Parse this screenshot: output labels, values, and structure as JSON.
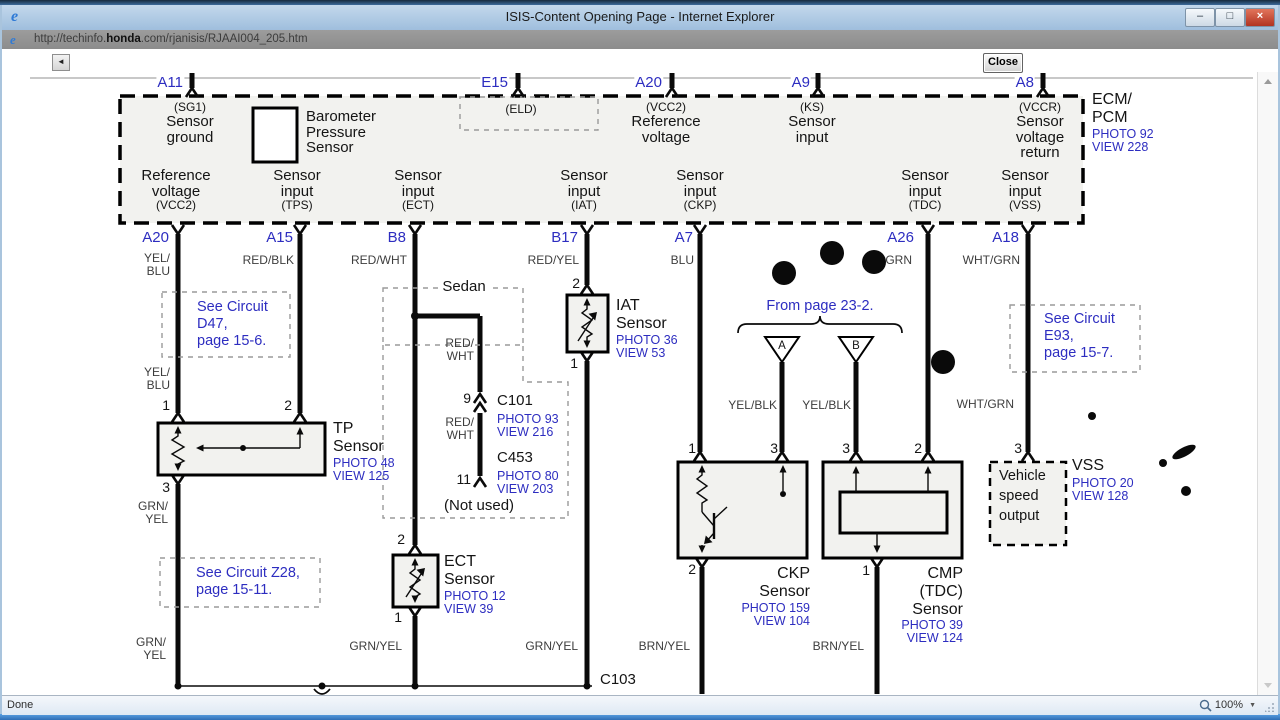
{
  "window": {
    "title": "ISIS-Content Opening Page - Internet Explorer",
    "controls": {
      "minimize": "–",
      "maximize": "□",
      "close": "×"
    }
  },
  "urlbar": {
    "prefix": "http://techinfo.",
    "domain": "honda",
    "suffix": ".com/rjanisis/RJAAI004_205.htm"
  },
  "toolbar": {
    "back": "◄",
    "close": "Close"
  },
  "statusbar": {
    "status": "Done",
    "zoom": "100%",
    "dropdown": "▼"
  },
  "colors": {
    "link_blue": "#2d2dc0",
    "wire_label": "#3d3d3d"
  },
  "ecm": {
    "title": "ECM/\nPCM",
    "photo": "PHOTO 92",
    "view": "VIEW 228",
    "pins_top": {
      "a11": {
        "id": "A11",
        "sub": "(SG1)",
        "desc": "Sensor\nground"
      },
      "e15": {
        "id": "E15",
        "sub": "(ELD)"
      },
      "a20": {
        "id": "A20",
        "sub": "(VCC2)",
        "desc": "Reference\nvoltage"
      },
      "a9": {
        "id": "A9",
        "sub": "(KS)",
        "desc": "Sensor\ninput"
      },
      "a8": {
        "id": "A8",
        "sub": "(VCCR)",
        "desc": "Sensor\nvoltage\nreturn"
      }
    },
    "barometer": "Barometer\nPressure\nSensor",
    "row_bottom": {
      "vcc2": {
        "desc": "Reference\nvoltage",
        "sub": "(VCC2)"
      },
      "tps": {
        "desc": "Sensor\ninput",
        "sub": "(TPS)"
      },
      "ect": {
        "desc": "Sensor\ninput",
        "sub": "(ECT)"
      },
      "iat": {
        "desc": "Sensor\ninput",
        "sub": "(IAT)"
      },
      "ckp": {
        "desc": "Sensor\ninput",
        "sub": "(CKP)"
      },
      "tdc": {
        "desc": "Sensor\ninput",
        "sub": "(TDC)"
      },
      "vss": {
        "desc": "Sensor\ninput",
        "sub": "(VSS)"
      }
    },
    "pins_bottom": {
      "a20": "A20",
      "a15": "A15",
      "b8": "B8",
      "b17": "B17",
      "a7": "A7",
      "a26": "A26",
      "a18": "A18"
    }
  },
  "wires": {
    "yel_blu": "YEL/\nBLU",
    "red_blk": "RED/BLK",
    "red_wht": "RED/WHT",
    "red_wht_stack": "RED/\nWHT",
    "red_yel": "RED/YEL",
    "blu": "BLU",
    "grn": "GRN",
    "wht_grn": "WHT/GRN",
    "yel_blk": "YEL/BLK",
    "grn_yel": "GRN/YEL",
    "grn_yel_stack": "GRN/\nYEL",
    "brn_yel": "BRN/YEL"
  },
  "links": {
    "d47": "See Circuit\nD47,\npage 15-6.",
    "z28": "See Circuit Z28,\npage 15-11.",
    "e93": "See Circuit\nE93,\npage 15-7.",
    "from_page": "From page 23-2."
  },
  "sensors": {
    "tp": {
      "name": "TP\nSensor",
      "photo": "PHOTO 48",
      "view": "VIEW 125"
    },
    "iat": {
      "name": "IAT\nSensor",
      "photo": "PHOTO 36",
      "view": "VIEW 53"
    },
    "ect": {
      "name": "ECT\nSensor",
      "photo": "PHOTO 12",
      "view": "VIEW 39"
    },
    "ckp": {
      "name": "CKP\nSensor",
      "photo": "PHOTO 159",
      "view": "VIEW 104"
    },
    "cmp": {
      "name": "CMP\n(TDC)\nSensor",
      "photo": "PHOTO 39",
      "view": "VIEW 124"
    },
    "vss": {
      "name": "VSS",
      "photo": "PHOTO 20",
      "view": "VIEW 128",
      "box_label": "Vehicle\nspeed\noutput"
    }
  },
  "connectors": {
    "sedan": "Sedan",
    "c101": {
      "name": "C101",
      "photo": "PHOTO 93",
      "view": "VIEW 216"
    },
    "c453": {
      "name": "C453",
      "photo": "PHOTO 80",
      "view": "VIEW 203"
    },
    "not_used": "(Not used)",
    "c103": "C103"
  },
  "pins": {
    "n1": "1",
    "n2": "2",
    "n3": "3",
    "n9": "9",
    "n11": "11",
    "tri_a": "A",
    "tri_b": "B"
  }
}
